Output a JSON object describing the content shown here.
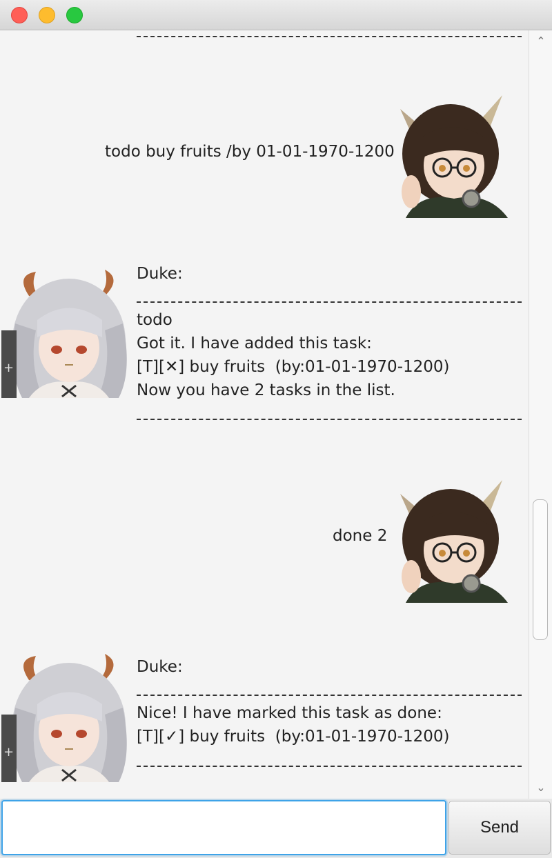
{
  "window": {
    "controls": [
      "close",
      "minimize",
      "maximize"
    ]
  },
  "chat": {
    "divider_text": "________________________________________________________",
    "messages": [
      {
        "sender": "user",
        "text": "todo buy fruits /by 01-01-1970-1200",
        "avatar_icon": "user-girl-glasses-avatar"
      },
      {
        "sender": "duke",
        "name_line": "Duke:",
        "lines": [
          "todo",
          "Got it. I have added this task:",
          "[T][✕] buy fruits  (by:01-01-1970-1200)",
          "Now you have 2 tasks in the list."
        ],
        "avatar_icon": "duke-silver-hair-avatar"
      },
      {
        "sender": "user",
        "text": "done 2",
        "avatar_icon": "user-girl-glasses-avatar"
      },
      {
        "sender": "duke",
        "name_line": "Duke:",
        "lines": [
          "Nice! I have marked this task as done:",
          "[T][✓] buy fruits  (by:01-01-1970-1200)"
        ],
        "avatar_icon": "duke-silver-hair-avatar"
      }
    ]
  },
  "input": {
    "value": "",
    "placeholder": ""
  },
  "send_button": {
    "label": "Send"
  },
  "colors": {
    "input_focus": "#3ea3e8",
    "chat_bg": "#f4f4f4"
  }
}
